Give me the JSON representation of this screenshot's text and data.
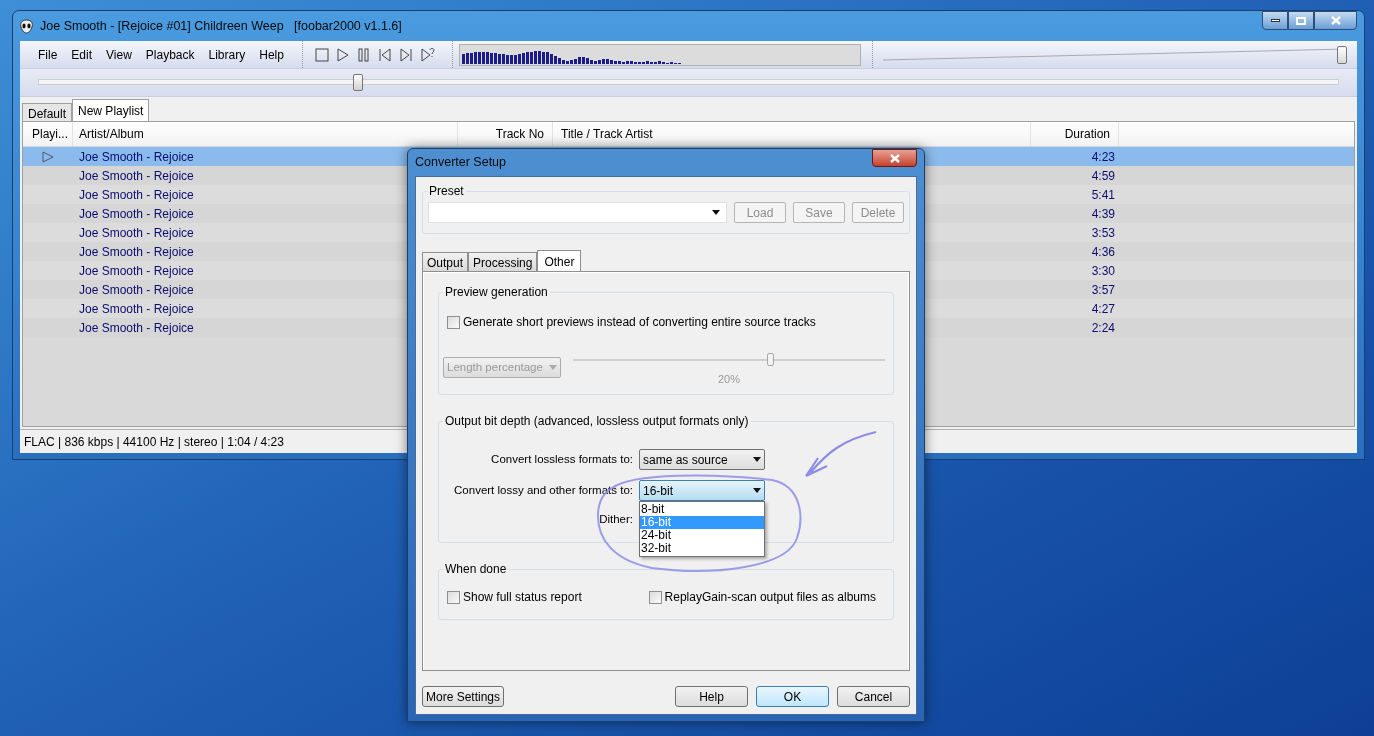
{
  "window": {
    "title": "Joe Smooth - [Rejoice #01] Childreen Weep   [foobar2000 v1.1.6]"
  },
  "menu": [
    "File",
    "Edit",
    "View",
    "Playback",
    "Library",
    "Help"
  ],
  "volume": {
    "level": 1
  },
  "seekbar": {
    "level": 0.246
  },
  "playlist_tabs": [
    {
      "label": "Default",
      "selected": false
    },
    {
      "label": "New Playlist",
      "selected": true
    }
  ],
  "columns": [
    "Playi...",
    "Artist/Album",
    "Track No",
    "Title / Track Artist",
    "Duration"
  ],
  "rows": [
    {
      "playing": true,
      "selected": true,
      "artist_album": "Joe Smooth - Rejoice",
      "duration": "4:23"
    },
    {
      "playing": false,
      "selected": false,
      "artist_album": "Joe Smooth - Rejoice",
      "duration": "4:59"
    },
    {
      "playing": false,
      "selected": false,
      "artist_album": "Joe Smooth - Rejoice",
      "duration": "5:41"
    },
    {
      "playing": false,
      "selected": false,
      "artist_album": "Joe Smooth - Rejoice",
      "duration": "4:39"
    },
    {
      "playing": false,
      "selected": false,
      "artist_album": "Joe Smooth - Rejoice",
      "duration": "3:53"
    },
    {
      "playing": false,
      "selected": false,
      "artist_album": "Joe Smooth - Rejoice",
      "duration": "4:36"
    },
    {
      "playing": false,
      "selected": false,
      "artist_album": "Joe Smooth - Rejoice",
      "duration": "3:30"
    },
    {
      "playing": false,
      "selected": false,
      "artist_album": "Joe Smooth - Rejoice",
      "duration": "3:57"
    },
    {
      "playing": false,
      "selected": false,
      "artist_album": "Joe Smooth - Rejoice",
      "duration": "4:27"
    },
    {
      "playing": false,
      "selected": false,
      "artist_album": "Joe Smooth - Rejoice",
      "duration": "2:24"
    }
  ],
  "status_bar": "FLAC | 836 kbps | 44100 Hz | stereo | 1:04 / 4:23",
  "dialog": {
    "title": "Converter Setup",
    "preset": {
      "label": "Preset",
      "buttons": [
        {
          "label": "Load",
          "disabled": true
        },
        {
          "label": "Save",
          "disabled": true
        },
        {
          "label": "Delete",
          "disabled": true
        }
      ]
    },
    "tabs": [
      {
        "label": "Output",
        "selected": false
      },
      {
        "label": "Processing",
        "selected": false
      },
      {
        "label": "Other",
        "selected": true
      }
    ],
    "preview": {
      "title": "Preview generation",
      "checkbox": {
        "label": "Generate short previews instead of converting entire source tracks",
        "checked": false
      },
      "mode": {
        "value": "Length percentage",
        "disabled": true
      },
      "slider": {
        "level": 0.63,
        "reading": "20%"
      }
    },
    "bit_depth": {
      "title": "Output bit depth (advanced, lossless output formats only)",
      "rows": [
        {
          "label": "Convert lossless formats to:",
          "value": "same as source",
          "open": false
        },
        {
          "label": "Convert lossy and other formats to:",
          "value": "16-bit",
          "open": true,
          "options": [
            {
              "label": "8-bit",
              "selected": false
            },
            {
              "label": "16-bit",
              "selected": true
            },
            {
              "label": "24-bit",
              "selected": false
            },
            {
              "label": "32-bit",
              "selected": false
            }
          ]
        }
      ],
      "dither_label": "Dither:"
    },
    "when_done": {
      "title": "When done",
      "checkboxes": [
        {
          "label": "Show full status report",
          "checked": false
        },
        {
          "label": "ReplayGain-scan output files as albums",
          "checked": false
        }
      ]
    },
    "buttons": [
      {
        "label": "More Settings",
        "default": false
      },
      {
        "label": "Help",
        "default": false
      },
      {
        "label": "OK",
        "default": true
      },
      {
        "label": "Cancel",
        "default": false
      }
    ]
  }
}
